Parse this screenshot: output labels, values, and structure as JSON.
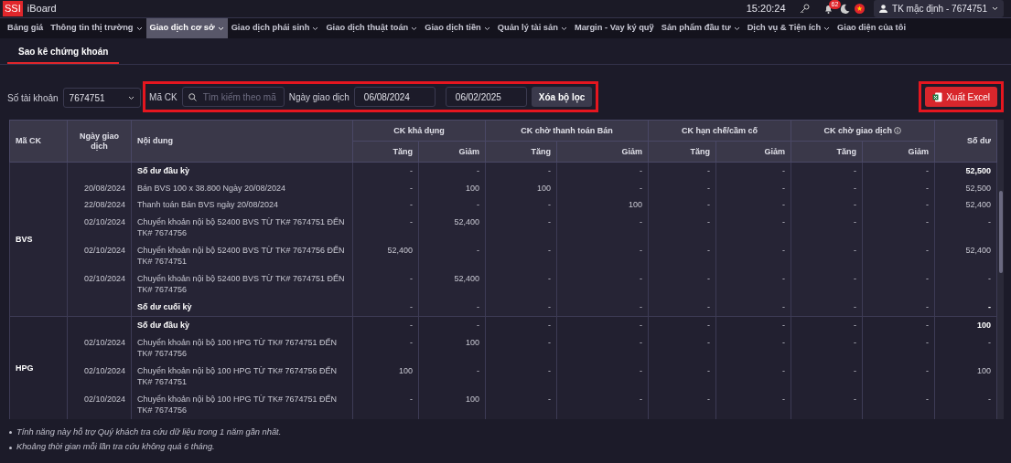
{
  "app": {
    "logo": "SSI",
    "title": "iBoard",
    "time": "15:20:24",
    "notification_count": "62",
    "account": "TK mặc định - 7674751"
  },
  "menu": [
    {
      "label": "Bảng giá",
      "caret": false,
      "selected": false
    },
    {
      "label": "Thông tin thị trường",
      "caret": true,
      "selected": false
    },
    {
      "label": "Giao dịch cơ sở",
      "caret": true,
      "selected": true
    },
    {
      "label": "Giao dịch phái sinh",
      "caret": true,
      "selected": false
    },
    {
      "label": "Giao dịch thuật toán",
      "caret": true,
      "selected": false
    },
    {
      "label": "Giao dịch tiền",
      "caret": true,
      "selected": false
    },
    {
      "label": "Quản lý tài sản",
      "caret": true,
      "selected": false
    },
    {
      "label": "Margin - Vay ký quỹ",
      "caret": false,
      "selected": false
    },
    {
      "label": "Sản phẩm đầu tư",
      "caret": true,
      "selected": false
    },
    {
      "label": "Dịch vụ & Tiện ích",
      "caret": true,
      "selected": false
    },
    {
      "label": "Giao diện của tôi",
      "caret": false,
      "selected": false
    }
  ],
  "tabs": [
    {
      "label": "Sao kê chứng khoán",
      "selected": true
    }
  ],
  "filters": {
    "account_label": "Số tài khoản",
    "account": "7674751",
    "symbol_label": "Mã CK",
    "symbol_placeholder": "Tìm kiếm theo mã",
    "date_label": "Ngày giao dịch",
    "date_from": "06/08/2024",
    "date_to": "06/02/2025",
    "clear_button": "Xóa bộ lọc",
    "export_button": "Xuất Excel"
  },
  "table": {
    "symbol": "Mã CK",
    "date": "Ngày giao dịch",
    "content": "Nội dung",
    "balance": "Số dư",
    "groups": [
      {
        "label": "CK khả dụng",
        "info": false
      },
      {
        "label": "CK chờ thanh toán Bán",
        "info": false
      },
      {
        "label": "CK hạn chế/cầm cố",
        "info": false
      },
      {
        "label": "CK chờ giao dịch",
        "info": true
      }
    ],
    "subcolumns": [
      "Tăng",
      "Giảm",
      "Tăng",
      "Giảm",
      "Tăng",
      "Giảm",
      "Tăng",
      "Giảm"
    ],
    "stocks": [
      {
        "symbol": "BVS",
        "rows": [
          {
            "kind": "opening",
            "date": "",
            "content": "Số dư đầu kỳ",
            "values": [
              "-",
              "-",
              "-",
              "-",
              "-",
              "-",
              "-",
              "-"
            ],
            "balance": "52,500"
          },
          {
            "kind": "entry",
            "date": "20/08/2024",
            "content": "Bán BVS 100 x 38.800 Ngày 20/08/2024",
            "values": [
              "-",
              "100",
              "100",
              "-",
              "-",
              "-",
              "-",
              "-"
            ],
            "balance": "52,500"
          },
          {
            "kind": "entry",
            "date": "22/08/2024",
            "content": "Thanh toán Bán BVS ngày 20/08/2024",
            "values": [
              "-",
              "-",
              "-",
              "100",
              "-",
              "-",
              "-",
              "-"
            ],
            "balance": "52,400"
          },
          {
            "kind": "entry",
            "date": "02/10/2024",
            "content": "Chuyển khoản nội bộ 52400 BVS TỪ TK# 7674751 ĐẾN TK# 7674756",
            "values": [
              "-",
              "52,400",
              "-",
              "-",
              "-",
              "-",
              "-",
              "-"
            ],
            "balance": "-"
          },
          {
            "kind": "entry",
            "date": "02/10/2024",
            "content": "Chuyển khoản nội bộ 52400 BVS TỪ TK# 7674756 ĐẾN TK# 7674751",
            "values": [
              "52,400",
              "-",
              "-",
              "-",
              "-",
              "-",
              "-",
              "-"
            ],
            "balance": "52,400"
          },
          {
            "kind": "entry",
            "date": "02/10/2024",
            "content": "Chuyển khoản nội bộ 52400 BVS TỪ TK# 7674751 ĐẾN TK# 7674756",
            "values": [
              "-",
              "52,400",
              "-",
              "-",
              "-",
              "-",
              "-",
              "-"
            ],
            "balance": "-"
          },
          {
            "kind": "closing",
            "date": "",
            "content": "Số dư cuối kỳ",
            "values": [
              "-",
              "-",
              "-",
              "-",
              "-",
              "-",
              "-",
              "-"
            ],
            "balance": "-"
          }
        ]
      },
      {
        "symbol": "HPG",
        "rows": [
          {
            "kind": "opening",
            "date": "",
            "content": "Số dư đầu kỳ",
            "values": [
              "-",
              "-",
              "-",
              "-",
              "-",
              "-",
              "-",
              "-"
            ],
            "balance": "100"
          },
          {
            "kind": "entry",
            "date": "02/10/2024",
            "content": "Chuyển khoản nội bộ 100 HPG TỪ TK# 7674751 ĐẾN TK# 7674756",
            "values": [
              "-",
              "100",
              "-",
              "-",
              "-",
              "-",
              "-",
              "-"
            ],
            "balance": "-"
          },
          {
            "kind": "entry",
            "date": "02/10/2024",
            "content": "Chuyển khoản nội bộ 100 HPG TỪ TK# 7674756 ĐẾN TK# 7674751",
            "values": [
              "100",
              "-",
              "-",
              "-",
              "-",
              "-",
              "-",
              "-"
            ],
            "balance": "100"
          },
          {
            "kind": "entry",
            "date": "02/10/2024",
            "content": "Chuyển khoản nội bộ 100 HPG TỪ TK# 7674751 ĐẾN TK# 7674756",
            "values": [
              "-",
              "100",
              "-",
              "-",
              "-",
              "-",
              "-",
              "-"
            ],
            "balance": "-"
          }
        ]
      }
    ]
  },
  "notes": [
    "Tính năng này hỗ trợ Quý khách tra cứu dữ liệu trong 1 năm gần nhất.",
    "Khoảng thời gian mỗi lần tra cứu không quá 6 tháng."
  ]
}
